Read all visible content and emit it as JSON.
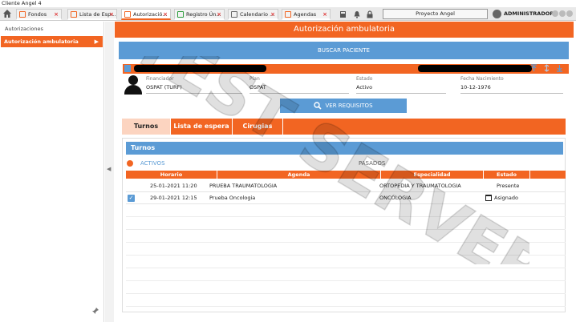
{
  "window": {
    "title": "Cliente Angel 4"
  },
  "tabs": [
    {
      "label": "Fondos",
      "close": "×",
      "active": false
    },
    {
      "label": "Lista de Esp...",
      "close": "×",
      "active": false
    },
    {
      "label": "Autorizació...",
      "close": "×",
      "active": true
    },
    {
      "label": "Registro Ún...",
      "close": "×",
      "active": false
    },
    {
      "label": "Calendario ...",
      "close": "×",
      "active": false
    },
    {
      "label": "Agendas",
      "close": "×",
      "active": false
    }
  ],
  "toolbar": {
    "project": "Proyecto Angel",
    "user": "ADMINISTRADOR"
  },
  "sidebar": {
    "header": "Autorizaciones",
    "item": "Autorización ambulatoria",
    "arrow": "▶"
  },
  "main": {
    "title": "Autorización ambulatoria",
    "search_button": "BUSCAR PACIENTE",
    "patient": {
      "financiador_label": "Financiador",
      "financiador": "OSPAT (TURF)",
      "plan_label": "Plan",
      "plan": "OSPAT",
      "estado_label": "Estado",
      "estado": "Activo",
      "nacimiento_label": "Fecha Nacimiento",
      "nacimiento": "10-12-1976"
    },
    "requisitos_button": "VER REQUISITOS",
    "section_tabs": [
      "Turnos",
      "Lista de espera",
      "Cirugias"
    ],
    "panel_title": "Turnos",
    "filter_active": "ACTIVOS",
    "filter_past": "PASADOS",
    "columns": [
      "Horario",
      "Agenda",
      "Especialidad",
      "Estado"
    ],
    "rows": [
      {
        "horario": "25-01-2021 11:20",
        "agenda": "PRUEBA TRAUMATOLOGIA",
        "especialidad": "ORTOPEDIA Y TRAUMATOLOGIA",
        "estado": "Presente",
        "checked": false
      },
      {
        "horario": "29-01-2021 12:15",
        "agenda": "Prueba Oncologia",
        "especialidad": "ONCOLOGIA",
        "estado": "Asignado",
        "checked": true
      }
    ]
  },
  "watermark": "TEST SERVER",
  "colors": {
    "accent": "#f26522",
    "blue": "#5b9bd5"
  }
}
